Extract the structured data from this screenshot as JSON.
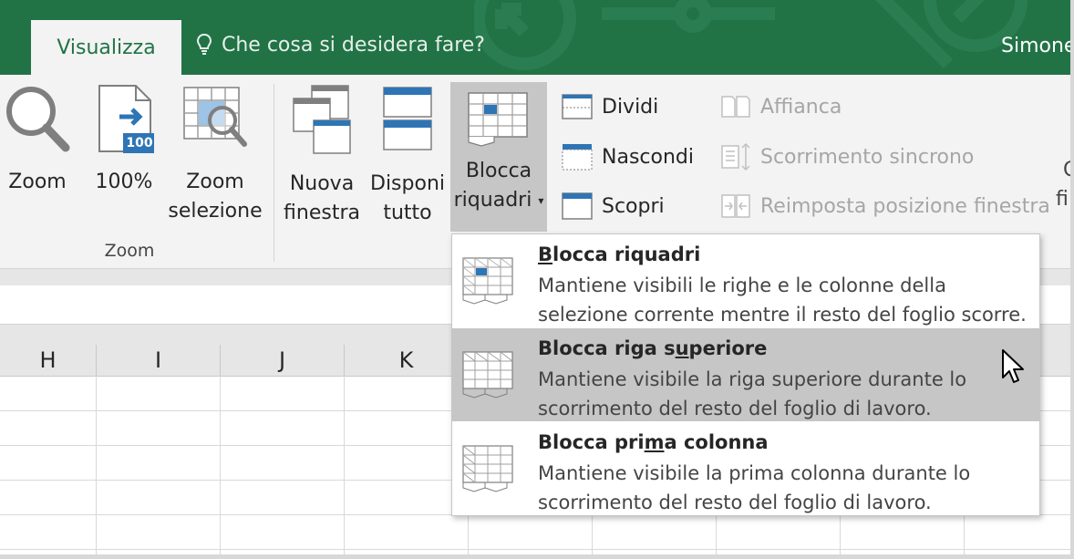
{
  "tabs": {
    "active_label": "Visualizza"
  },
  "tell_me": {
    "placeholder": "Che cosa si desidera fare?"
  },
  "user": {
    "name": "Simone"
  },
  "ribbon": {
    "zoom_group": {
      "label": "Zoom",
      "zoom_button": "Zoom",
      "zoom100_button": "100%",
      "zoom100_badge": "100",
      "zoom_selection_line1": "Zoom",
      "zoom_selection_line2": "selezione"
    },
    "window_group": {
      "new_window_line1": "Nuova",
      "new_window_line2": "finestra",
      "arrange_all_line1": "Disponi",
      "arrange_all_line2": "tutto",
      "freeze_line1": "Blocca",
      "freeze_line2": "riquadri",
      "split": "Dividi",
      "hide": "Nascondi",
      "unhide": "Scopri",
      "side_by_side": "Affianca",
      "sync_scroll": "Scorrimento sincrono",
      "reset_position": "Reimposta posizione finestra",
      "cut_off_1": "C",
      "cut_off_2": "fi"
    }
  },
  "columns": [
    "H",
    "I",
    "J",
    "K"
  ],
  "freeze_menu": {
    "items": [
      {
        "title_prefix": "",
        "title_underlined": "B",
        "title_suffix": "locca riquadri",
        "description": "Mantiene visibili le righe e le colonne della selezione corrente mentre il resto del foglio scorre."
      },
      {
        "title_prefix": "Blocca riga s",
        "title_underlined": "u",
        "title_suffix": "periore",
        "description": "Mantiene visibile la riga superiore durante lo scorrimento del resto del foglio di lavoro."
      },
      {
        "title_prefix": "Blocca pri",
        "title_underlined": "m",
        "title_suffix": "a colonna",
        "description": "Mantiene visibile la prima colonna durante lo scorrimento del resto del foglio di lavoro."
      }
    ]
  },
  "colors": {
    "title_bar": "#217346",
    "ribbon": "#f3f3f3",
    "accent_blue": "#2e75b6",
    "hover": "#c6c6c6"
  }
}
